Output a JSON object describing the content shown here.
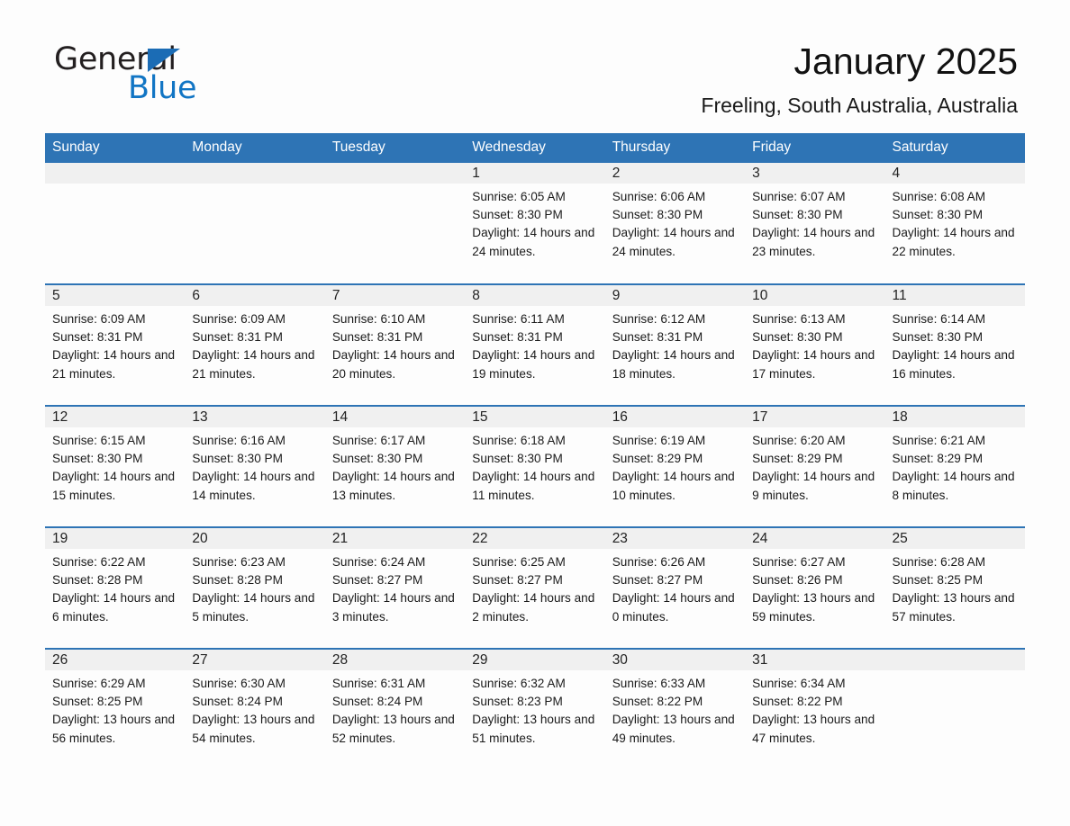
{
  "brand": {
    "name_part1": "General",
    "name_part2": "Blue",
    "triangle_icon": "triangle-icon",
    "accent_color": "#1175c4",
    "triangle_color": "#1b6cb5"
  },
  "header": {
    "title": "January 2025",
    "subtitle": "Freeling, South Australia, Australia"
  },
  "calendar": {
    "header_bg": "#2e74b5",
    "header_text_color": "#ffffff",
    "datenum_bg": "#f0f0f0",
    "weekday_headers": [
      "Sunday",
      "Monday",
      "Tuesday",
      "Wednesday",
      "Thursday",
      "Friday",
      "Saturday"
    ],
    "weeks": [
      [
        {
          "day": "",
          "blank": true
        },
        {
          "day": "",
          "blank": true
        },
        {
          "day": "",
          "blank": true
        },
        {
          "day": "1",
          "sunrise": "Sunrise: 6:05 AM",
          "sunset": "Sunset: 8:30 PM",
          "daylight": "Daylight: 14 hours and 24 minutes."
        },
        {
          "day": "2",
          "sunrise": "Sunrise: 6:06 AM",
          "sunset": "Sunset: 8:30 PM",
          "daylight": "Daylight: 14 hours and 24 minutes."
        },
        {
          "day": "3",
          "sunrise": "Sunrise: 6:07 AM",
          "sunset": "Sunset: 8:30 PM",
          "daylight": "Daylight: 14 hours and 23 minutes."
        },
        {
          "day": "4",
          "sunrise": "Sunrise: 6:08 AM",
          "sunset": "Sunset: 8:30 PM",
          "daylight": "Daylight: 14 hours and 22 minutes."
        }
      ],
      [
        {
          "day": "5",
          "sunrise": "Sunrise: 6:09 AM",
          "sunset": "Sunset: 8:31 PM",
          "daylight": "Daylight: 14 hours and 21 minutes."
        },
        {
          "day": "6",
          "sunrise": "Sunrise: 6:09 AM",
          "sunset": "Sunset: 8:31 PM",
          "daylight": "Daylight: 14 hours and 21 minutes."
        },
        {
          "day": "7",
          "sunrise": "Sunrise: 6:10 AM",
          "sunset": "Sunset: 8:31 PM",
          "daylight": "Daylight: 14 hours and 20 minutes."
        },
        {
          "day": "8",
          "sunrise": "Sunrise: 6:11 AM",
          "sunset": "Sunset: 8:31 PM",
          "daylight": "Daylight: 14 hours and 19 minutes."
        },
        {
          "day": "9",
          "sunrise": "Sunrise: 6:12 AM",
          "sunset": "Sunset: 8:31 PM",
          "daylight": "Daylight: 14 hours and 18 minutes."
        },
        {
          "day": "10",
          "sunrise": "Sunrise: 6:13 AM",
          "sunset": "Sunset: 8:30 PM",
          "daylight": "Daylight: 14 hours and 17 minutes."
        },
        {
          "day": "11",
          "sunrise": "Sunrise: 6:14 AM",
          "sunset": "Sunset: 8:30 PM",
          "daylight": "Daylight: 14 hours and 16 minutes."
        }
      ],
      [
        {
          "day": "12",
          "sunrise": "Sunrise: 6:15 AM",
          "sunset": "Sunset: 8:30 PM",
          "daylight": "Daylight: 14 hours and 15 minutes."
        },
        {
          "day": "13",
          "sunrise": "Sunrise: 6:16 AM",
          "sunset": "Sunset: 8:30 PM",
          "daylight": "Daylight: 14 hours and 14 minutes."
        },
        {
          "day": "14",
          "sunrise": "Sunrise: 6:17 AM",
          "sunset": "Sunset: 8:30 PM",
          "daylight": "Daylight: 14 hours and 13 minutes."
        },
        {
          "day": "15",
          "sunrise": "Sunrise: 6:18 AM",
          "sunset": "Sunset: 8:30 PM",
          "daylight": "Daylight: 14 hours and 11 minutes."
        },
        {
          "day": "16",
          "sunrise": "Sunrise: 6:19 AM",
          "sunset": "Sunset: 8:29 PM",
          "daylight": "Daylight: 14 hours and 10 minutes."
        },
        {
          "day": "17",
          "sunrise": "Sunrise: 6:20 AM",
          "sunset": "Sunset: 8:29 PM",
          "daylight": "Daylight: 14 hours and 9 minutes."
        },
        {
          "day": "18",
          "sunrise": "Sunrise: 6:21 AM",
          "sunset": "Sunset: 8:29 PM",
          "daylight": "Daylight: 14 hours and 8 minutes."
        }
      ],
      [
        {
          "day": "19",
          "sunrise": "Sunrise: 6:22 AM",
          "sunset": "Sunset: 8:28 PM",
          "daylight": "Daylight: 14 hours and 6 minutes."
        },
        {
          "day": "20",
          "sunrise": "Sunrise: 6:23 AM",
          "sunset": "Sunset: 8:28 PM",
          "daylight": "Daylight: 14 hours and 5 minutes."
        },
        {
          "day": "21",
          "sunrise": "Sunrise: 6:24 AM",
          "sunset": "Sunset: 8:27 PM",
          "daylight": "Daylight: 14 hours and 3 minutes."
        },
        {
          "day": "22",
          "sunrise": "Sunrise: 6:25 AM",
          "sunset": "Sunset: 8:27 PM",
          "daylight": "Daylight: 14 hours and 2 minutes."
        },
        {
          "day": "23",
          "sunrise": "Sunrise: 6:26 AM",
          "sunset": "Sunset: 8:27 PM",
          "daylight": "Daylight: 14 hours and 0 minutes."
        },
        {
          "day": "24",
          "sunrise": "Sunrise: 6:27 AM",
          "sunset": "Sunset: 8:26 PM",
          "daylight": "Daylight: 13 hours and 59 minutes."
        },
        {
          "day": "25",
          "sunrise": "Sunrise: 6:28 AM",
          "sunset": "Sunset: 8:25 PM",
          "daylight": "Daylight: 13 hours and 57 minutes."
        }
      ],
      [
        {
          "day": "26",
          "sunrise": "Sunrise: 6:29 AM",
          "sunset": "Sunset: 8:25 PM",
          "daylight": "Daylight: 13 hours and 56 minutes."
        },
        {
          "day": "27",
          "sunrise": "Sunrise: 6:30 AM",
          "sunset": "Sunset: 8:24 PM",
          "daylight": "Daylight: 13 hours and 54 minutes."
        },
        {
          "day": "28",
          "sunrise": "Sunrise: 6:31 AM",
          "sunset": "Sunset: 8:24 PM",
          "daylight": "Daylight: 13 hours and 52 minutes."
        },
        {
          "day": "29",
          "sunrise": "Sunrise: 6:32 AM",
          "sunset": "Sunset: 8:23 PM",
          "daylight": "Daylight: 13 hours and 51 minutes."
        },
        {
          "day": "30",
          "sunrise": "Sunrise: 6:33 AM",
          "sunset": "Sunset: 8:22 PM",
          "daylight": "Daylight: 13 hours and 49 minutes."
        },
        {
          "day": "31",
          "sunrise": "Sunrise: 6:34 AM",
          "sunset": "Sunset: 8:22 PM",
          "daylight": "Daylight: 13 hours and 47 minutes."
        },
        {
          "day": "",
          "blank": true
        }
      ]
    ]
  }
}
